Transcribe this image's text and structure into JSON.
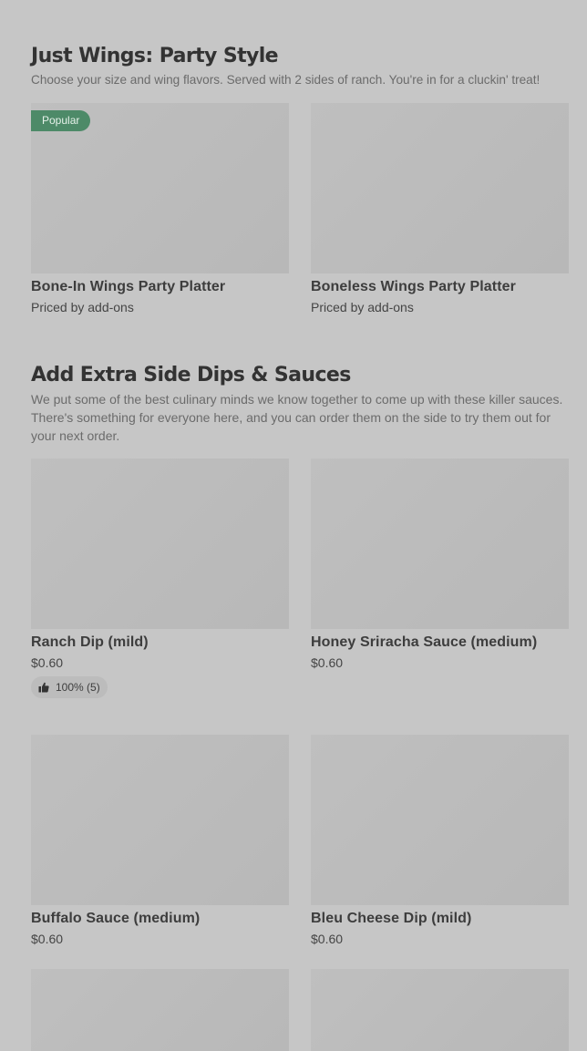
{
  "sections": [
    {
      "title": "Just Wings: Party Style",
      "description": "Choose your size and wing flavors. Served with 2 sides of ranch. You're in for a cluckin' treat!",
      "items": [
        {
          "name": "Bone-In Wings Party Platter",
          "price": "Priced by add-ons",
          "badge": "Popular"
        },
        {
          "name": "Boneless Wings Party Platter",
          "price": "Priced by add-ons"
        }
      ]
    },
    {
      "title": "Add Extra Side Dips & Sauces",
      "description": "We put some of the best culinary minds we know together to come up with these killer sauces. There's something for everyone here, and you can order them on the side to try them out for your next order.",
      "items": [
        {
          "name": "Ranch Dip (mild)",
          "price": "$0.60",
          "rating": "100% (5)"
        },
        {
          "name": "Honey Sriracha Sauce (medium)",
          "price": "$0.60"
        },
        {
          "name": "Buffalo Sauce (medium)",
          "price": "$0.60"
        },
        {
          "name": "Bleu Cheese Dip (mild)",
          "price": "$0.60"
        }
      ]
    }
  ],
  "icons": {
    "rating": "thumbs-up-icon"
  },
  "colors": {
    "background": "#c6c6c6",
    "badge": "#4d8a68",
    "image_placeholder": "#bcbcbc"
  }
}
